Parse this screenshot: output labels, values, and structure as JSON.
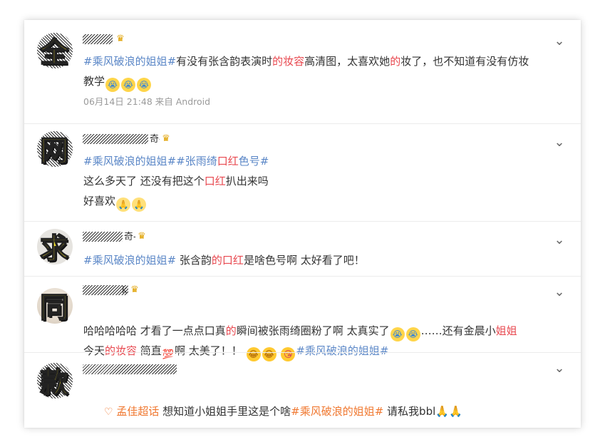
{
  "posts": [
    {
      "stamp": "全",
      "name_tail": "",
      "segments": [
        {
          "text": "#乘风破浪的姐姐#",
          "style": "tag"
        },
        {
          "text": "有没有张含韵表演时",
          "style": "plain"
        },
        {
          "text": "的妆容",
          "style": "hl"
        },
        {
          "text": "高清图，太喜欢她",
          "style": "plain"
        },
        {
          "text": "的",
          "style": "hl"
        },
        {
          "text": "妆了，也不知道有没有仿妆",
          "style": "plain"
        }
      ],
      "line2": "教学",
      "line2_emojis": [
        "cry-emoji",
        "cry-emoji",
        "cry-emoji"
      ],
      "meta": "06月14日 21:48  来自 Android"
    },
    {
      "stamp": "网",
      "name_tail": "奇-",
      "line1_tags": [
        {
          "text": "#乘风破浪的姐姐#",
          "style": "tag"
        },
        {
          "text": "#张雨绮",
          "style": "tag"
        },
        {
          "text": "口红",
          "style": "hl"
        },
        {
          "text": "色号#",
          "style": "tag"
        }
      ],
      "line2_parts": [
        {
          "text": "这么多天了 还没有把这个",
          "style": "plain"
        },
        {
          "text": "口红",
          "style": "hl"
        },
        {
          "text": "扒出来吗",
          "style": "plain"
        }
      ],
      "line3": "好喜欢",
      "line3_emojis": [
        "pray-emoji",
        "pray-emoji"
      ]
    },
    {
      "stamp": "求",
      "name_tail": "奇-",
      "parts": [
        {
          "text": "#乘风破浪的姐姐#",
          "style": "tag"
        },
        {
          "text": " 张含韵",
          "style": "plain"
        },
        {
          "text": "的口红",
          "style": "hl"
        },
        {
          "text": "是啥色号啊 太好看了吧！",
          "style": "plain"
        }
      ]
    },
    {
      "stamp": "同",
      "name_tail": "k",
      "line1a": "哈哈哈哈哈 才看了一点点口真",
      "line1_hl": "的",
      "line1b": "瞬间被张雨绮圈粉了啊 太真实了",
      "line1c": "……还有金晨小",
      "line1_end_hl": "姐姐",
      "line2a": "今天",
      "line2_hl": "的妆容",
      "line2b": " 简直",
      "hundred": "💯",
      "line2c": "啊 太美了！！ ",
      "line2_tag": "#乘风破浪的姐姐#"
    },
    {
      "stamp": "款",
      "super_icon": "♡",
      "super_label": "孟佳超话",
      "text": " 想知道小姐姐手里这是个啥",
      "tag": "#乘风破浪的姐姐#",
      "tail": " 请私我bbl",
      "hands": "🙏🙏"
    }
  ],
  "colors": {
    "tag": "#5b87c7",
    "highlight": "#e8484f",
    "super": "#f07830",
    "stamp": "#f5e12a"
  }
}
